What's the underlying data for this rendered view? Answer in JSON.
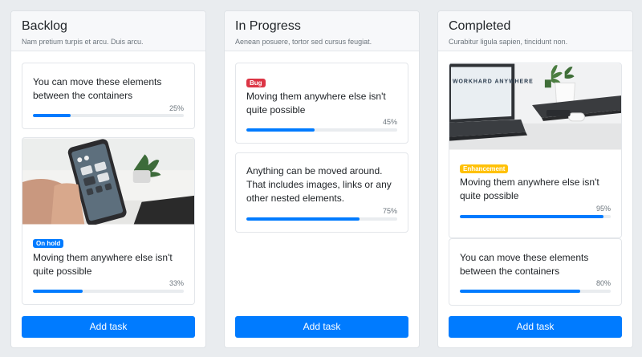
{
  "columns": [
    {
      "title": "Backlog",
      "subtitle": "Nam pretium turpis et arcu. Duis arcu.",
      "add_label": "Add task",
      "cards": [
        {
          "text": "You can move these elements between the containers",
          "percent_label": "25%",
          "progress": 0.25
        },
        {
          "image": "phone-hand-photo",
          "badge": "On hold",
          "badge_color": "#007bff",
          "text": "Moving them anywhere else isn't quite possible",
          "percent_label": "33%",
          "progress": 0.33
        }
      ]
    },
    {
      "title": "In Progress",
      "subtitle": "Aenean posuere, tortor sed cursus feugiat.",
      "add_label": "Add task",
      "cards": [
        {
          "badge": "Bug",
          "badge_color": "#dc3545",
          "text": "Moving them anywhere else isn't quite possible",
          "percent_label": "45%",
          "progress": 0.45
        },
        {
          "text": "Anything can be moved around. That includes images, links or any other nested elements.",
          "percent_label": "75%",
          "progress": 0.75
        }
      ]
    },
    {
      "title": "Completed",
      "subtitle": "Curabitur ligula sapien, tincidunt non.",
      "add_label": "Add task",
      "cards": [
        {
          "image": "laptop-desk-photo",
          "image_text": "WORKHARD ANYWHERE",
          "badge": "Enhancement",
          "badge_color": "#ffc107",
          "text": "Moving them anywhere else isn't quite possible",
          "percent_label": "95%",
          "progress": 0.95
        },
        {
          "text": "You can move these elements between the containers",
          "percent_label": "80%",
          "progress": 0.8
        }
      ]
    }
  ],
  "colors": {
    "accent": "#007bff",
    "page_bg": "#e9ecef",
    "track": "#e9ecef"
  }
}
